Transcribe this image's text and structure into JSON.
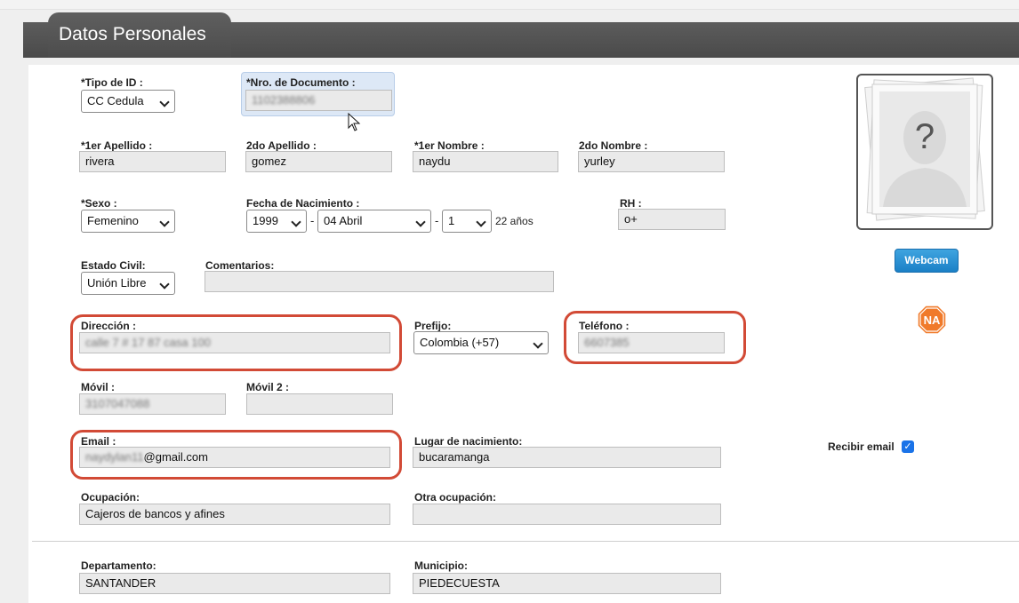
{
  "header": {
    "title": "Datos Personales"
  },
  "form": {
    "tipo_id": {
      "label": "*Tipo de ID :",
      "value": "CC Cedula"
    },
    "nro_documento": {
      "label": "*Nro. de Documento :",
      "value": "1102388806"
    },
    "primer_apellido": {
      "label": "*1er Apellido :",
      "value": "rivera"
    },
    "segundo_apellido": {
      "label": "2do Apellido :",
      "value": "gomez"
    },
    "primer_nombre": {
      "label": "*1er Nombre :",
      "value": "naydu"
    },
    "segundo_nombre": {
      "label": "2do Nombre :",
      "value": "yurley"
    },
    "sexo": {
      "label": "*Sexo :",
      "value": "Femenino"
    },
    "fecha_nacimiento": {
      "label": "Fecha de Nacimiento :",
      "year": "1999",
      "month": "04 Abril",
      "day": "1",
      "separator": "-",
      "age": "22 años"
    },
    "rh": {
      "label": "RH :",
      "value": "o+"
    },
    "estado_civil": {
      "label": "Estado Civil:",
      "value": "Unión Libre"
    },
    "comentarios": {
      "label": "Comentarios:",
      "value": ""
    },
    "direccion": {
      "label": "Dirección :",
      "value": "calle 7 # 17 87 casa 100"
    },
    "prefijo": {
      "label": "Prefijo:",
      "value": "Colombia (+57)"
    },
    "telefono": {
      "label": "Teléfono :",
      "value": "6607385"
    },
    "movil": {
      "label": "Móvil :",
      "value": "3107047088"
    },
    "movil2": {
      "label": "Móvil 2 :",
      "value": ""
    },
    "email": {
      "label": "Email :",
      "value_blurred": "naydylan11",
      "value_domain": "@gmail.com"
    },
    "lugar_nacimiento": {
      "label": "Lugar de nacimiento:",
      "value": "bucaramanga"
    },
    "recibir_email": {
      "label": "Recibir email",
      "checked": true
    },
    "ocupacion": {
      "label": "Ocupación:",
      "value": "Cajeros de bancos y afines"
    },
    "otra_ocupacion": {
      "label": "Otra ocupación:",
      "value": ""
    },
    "departamento": {
      "label": "Departamento:",
      "value": "SANTANDER"
    },
    "municipio": {
      "label": "Municipio:",
      "value": "PIEDECUESTA"
    }
  },
  "photo": {
    "placeholder_glyph": "?"
  },
  "webcam": {
    "label": "Webcam"
  },
  "na_badge": {
    "text": "NA",
    "color": "#f07a2a"
  },
  "highlight_color": "#d24a36"
}
